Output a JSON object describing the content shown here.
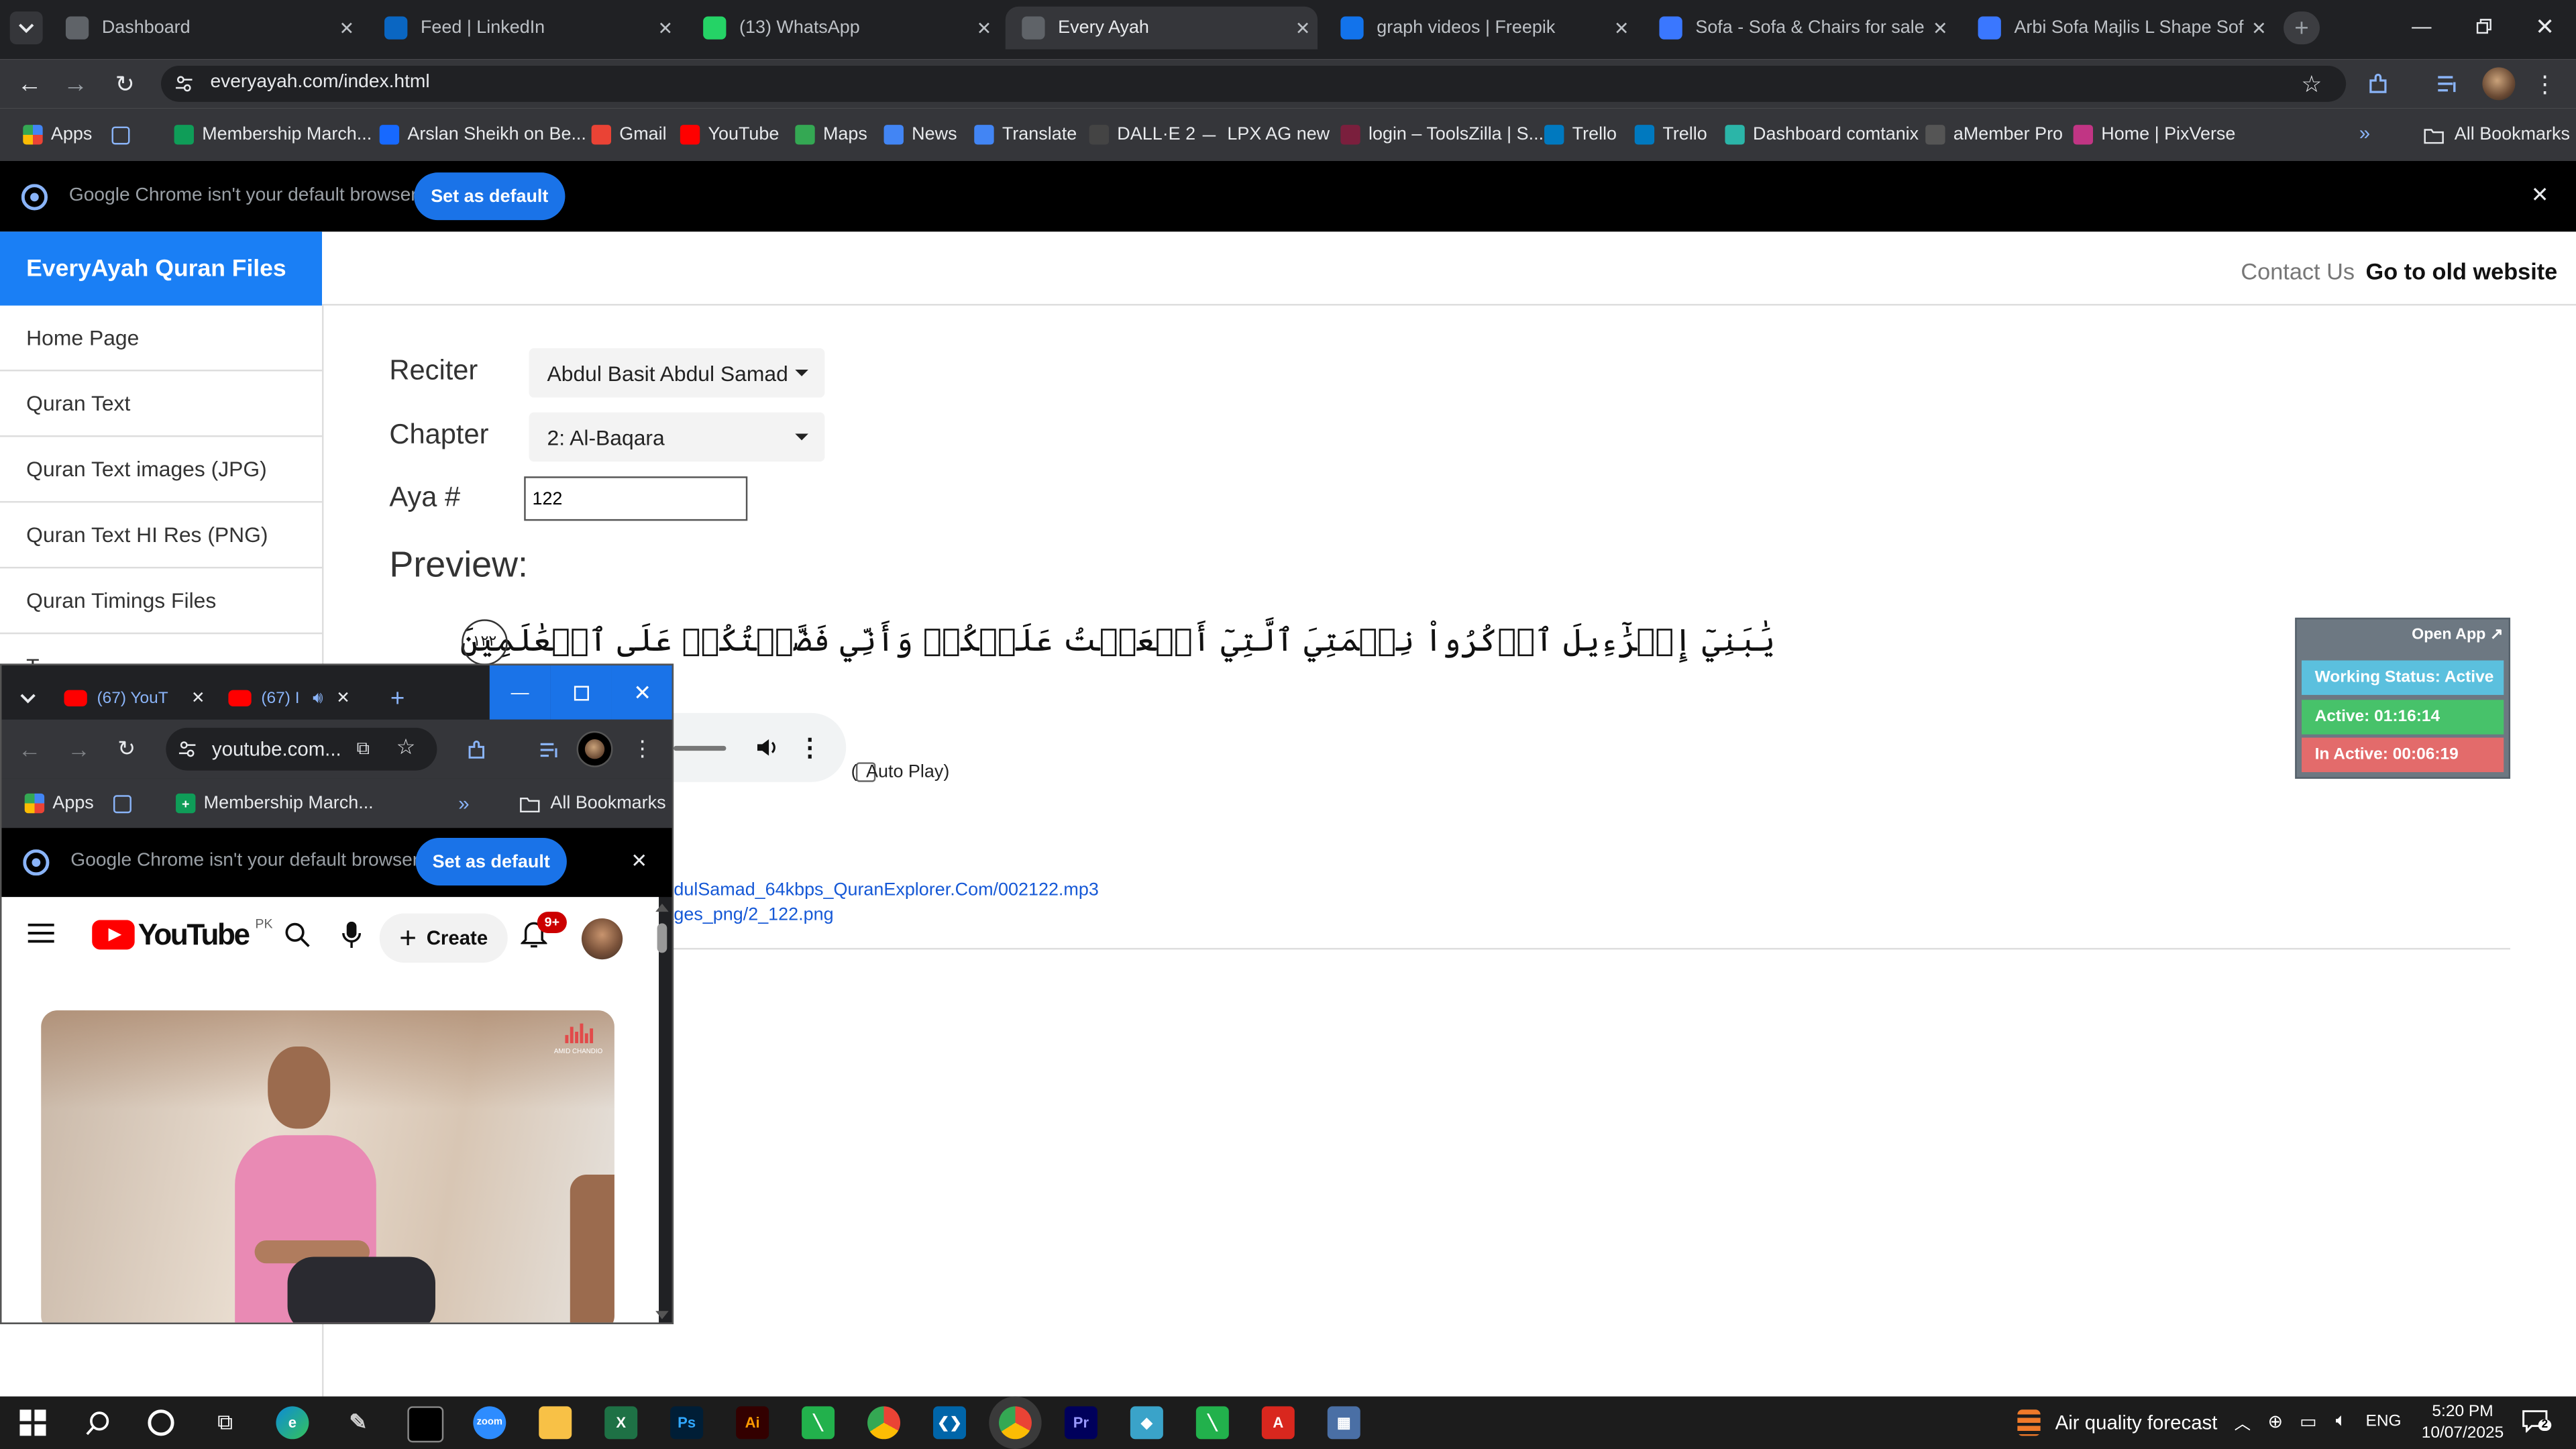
{
  "browser": {
    "tabs": [
      {
        "title": "Dashboard",
        "icon": "globe-icon",
        "color": "#5f6368"
      },
      {
        "title": "Feed | LinkedIn",
        "icon": "linkedin-icon",
        "color": "#0a66c2"
      },
      {
        "title": "(13) WhatsApp",
        "icon": "whatsapp-icon",
        "color": "#25d366"
      },
      {
        "title": "Every Ayah",
        "icon": "globe-icon",
        "color": "#5f6368"
      },
      {
        "title": "graph videos | Freepik",
        "icon": "freepik-icon",
        "color": "#1273eb"
      },
      {
        "title": "Sofa - Sofa & Chairs for sale in",
        "icon": "olx-icon",
        "color": "#3a77ff"
      },
      {
        "title": "Arbi Sofa Majlis L Shape Sofa -",
        "icon": "olx-icon",
        "color": "#3a77ff"
      }
    ],
    "url": "everyayah.com/index.html",
    "bookmarks": [
      {
        "label": "Apps",
        "icon": "apps-grid-icon"
      },
      {
        "label": "",
        "icon": "apps-icon"
      },
      {
        "label": "Membership March...",
        "icon": "sheets-icon"
      },
      {
        "label": "Arslan Sheikh on Be...",
        "icon": "behance-icon"
      },
      {
        "label": "Gmail",
        "icon": "gmail-icon"
      },
      {
        "label": "YouTube",
        "icon": "youtube-icon"
      },
      {
        "label": "Maps",
        "icon": "maps-icon"
      },
      {
        "label": "News",
        "icon": "news-icon"
      },
      {
        "label": "Translate",
        "icon": "translate-icon"
      },
      {
        "label": "DALL·E 2",
        "icon": "openai-icon"
      },
      {
        "label": "LPX AG new",
        "icon": "dash-icon"
      },
      {
        "label": "login – ToolsZilla | S...",
        "icon": "toolszilla-icon"
      },
      {
        "label": "Trello",
        "icon": "trello-icon"
      },
      {
        "label": "Trello",
        "icon": "trello-icon"
      },
      {
        "label": "Dashboard comtanix",
        "icon": "comtanix-icon"
      },
      {
        "label": "aMember Pro",
        "icon": "amember-icon"
      },
      {
        "label": "Home | PixVerse",
        "icon": "pixverse-icon"
      }
    ],
    "all_bookmarks": "All Bookmarks",
    "infobar": {
      "message": "Google Chrome isn't your default browser",
      "button": "Set as default"
    }
  },
  "site": {
    "brand": "EveryAyah Quran Files",
    "nav_right": {
      "contact": "Contact Us",
      "old": "Go to old website"
    },
    "sidebar": [
      "Home Page",
      "Quran Text",
      "Quran Text images (JPG)",
      "Quran Text HI Res (PNG)",
      "Quran Timings Files",
      "T"
    ],
    "form": {
      "reciter_label": "Reciter",
      "reciter_value": "Abdul Basit Abdul Samad",
      "chapter_label": "Chapter",
      "chapter_value": "2: Al-Baqara",
      "aya_label": "Aya #",
      "aya_value": "122"
    },
    "preview_label": "Preview:",
    "ayah_text": "يَٰبَنِيٓ إِسۡرَٰٓءِيلَ ٱذۡكُرُواْ نِعۡمَتِيَ ٱلَّتِيٓ أَنۡعَمۡتُ عَلَيۡكُمۡ وَأَنِّي فَضَّلۡتُكُمۡ عَلَى ٱلۡعَٰلَمِينَ",
    "ayah_number": "١٢٢",
    "autoplay_label": "(  Auto Play)",
    "mp3_link": "odulSamad_64kbps_QuranExplorer.Com/002122.mp3",
    "png_link": "ages_png/2_122.png",
    "extra_link": "t"
  },
  "widget": {
    "open_app": "Open App",
    "working": "Working Status: Active",
    "active": "Active: 01:16:14",
    "inactive": "In Active: 00:06:19"
  },
  "popup": {
    "tab1": "(67) YouT",
    "tab2": "(67) I",
    "url": "youtube.com...",
    "bookmark": "Membership March...",
    "apps": "Apps",
    "all_bookmarks": "All Bookmarks",
    "infobar": "Google Chrome isn't your default browser",
    "set_default": "Set as default",
    "yt_logo": "YouTube",
    "yt_country": "PK",
    "create": "Create",
    "notif_badge": "9+",
    "video_watermark": "AMID CHANDIO"
  },
  "taskbar": {
    "weather": "Air quality forecast",
    "lang": "ENG",
    "time": "5:20 PM",
    "date": "10/07/2025",
    "notif": "2"
  }
}
